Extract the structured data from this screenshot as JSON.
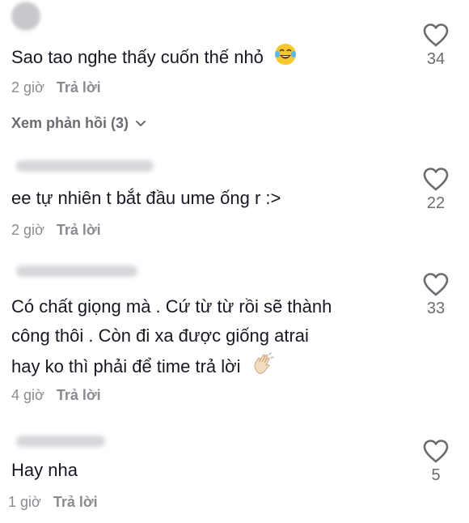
{
  "comments": [
    {
      "text": "Sao tao nghe thấy cuốn thế nhỏ",
      "emoji": "tears-of-joy-emoji",
      "time": "2 giờ",
      "reply_label": "Trả lời",
      "likes": "34",
      "view_replies": "Xem phản hồi (3)"
    },
    {
      "text": "ee tự nhiên t bắt đầu ume ống r :>",
      "time": "2 giờ",
      "reply_label": "Trả lời",
      "likes": "22"
    },
    {
      "text_lines": [
        "Có chất giọng mà . Cứ từ từ rồi sẽ thành",
        "công thôi . Còn đi xa được giống atrai",
        "hay ko thì phải để time trả lời"
      ],
      "emoji": "waving-hand-emoji",
      "time": "4 giờ",
      "reply_label": "Trả lời",
      "likes": "33"
    },
    {
      "text": "Hay nha",
      "time": "1 giờ",
      "reply_label": "Trả lời",
      "likes": "5"
    }
  ],
  "icons": {
    "like": "heart-outline-icon",
    "expand": "chevron-down-icon"
  },
  "colors": {
    "text": "#161823",
    "meta": "#8a8b91",
    "icon": "#6b6c72"
  }
}
